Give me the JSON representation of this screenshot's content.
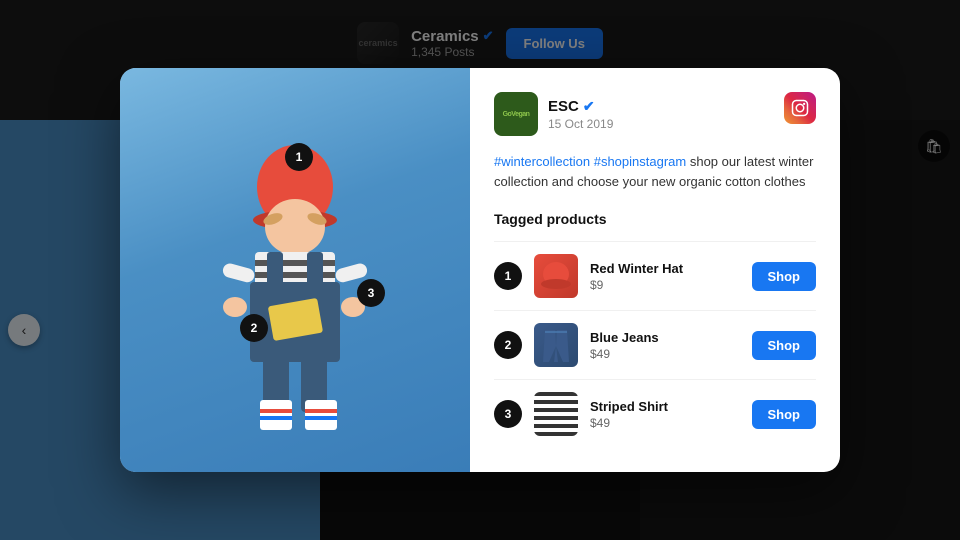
{
  "background": {
    "feed_name": "Ceramics",
    "feed_posts": "1,345 Posts",
    "follow_label": "Follow Us"
  },
  "modal": {
    "profile": {
      "avatar_label": "GoVegan",
      "name": "ESC",
      "date": "15 Oct 2019",
      "verified": true
    },
    "caption": {
      "hashtags": "#wintercollection #shopinstagram",
      "text": " shop our latest winter collection and choose your new  organic cotton clothes"
    },
    "tagged_title": "Tagged products",
    "products": [
      {
        "num": "1",
        "name": "Red Winter Hat",
        "price": "$9",
        "shop_label": "Shop"
      },
      {
        "num": "2",
        "name": "Blue Jeans",
        "price": "$49",
        "shop_label": "Shop"
      },
      {
        "num": "3",
        "name": "Striped Shirt",
        "price": "$49",
        "shop_label": "Shop"
      }
    ]
  },
  "nav": {
    "left_arrow": "‹",
    "right_arrow": "›"
  },
  "hotspots": [
    "1",
    "2",
    "3"
  ]
}
